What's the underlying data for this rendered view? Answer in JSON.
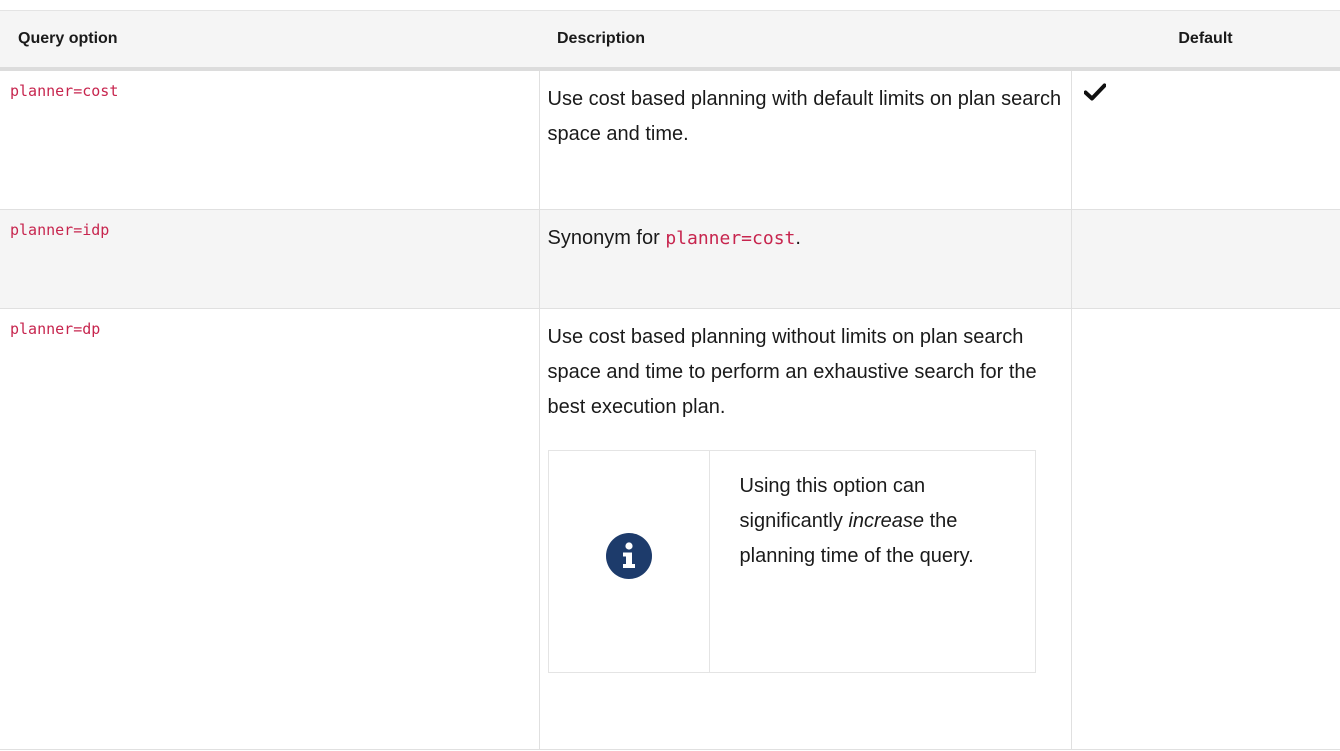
{
  "table": {
    "headers": {
      "option": "Query option",
      "description": "Description",
      "default": "Default"
    },
    "rows": [
      {
        "option": "planner=cost",
        "description": "Use cost based planning with default limits on plan search space and time.",
        "is_default": true
      },
      {
        "option": "planner=idp",
        "description_prefix": "Synonym for ",
        "description_code": "planner=cost",
        "description_suffix": ".",
        "is_default": false
      },
      {
        "option": "planner=dp",
        "description": "Use cost based planning without limits on plan search space and time to perform an exhaustive search for the best execution plan.",
        "is_default": false,
        "note": {
          "icon": "info-icon",
          "text_before": "Using this option can significantly ",
          "text_emphasis": "increase",
          "text_after": " the planning time of the query."
        }
      }
    ]
  },
  "colors": {
    "code": "#c7254e",
    "header_bg": "#f5f5f5",
    "info_icon": "#1d3b6b"
  }
}
